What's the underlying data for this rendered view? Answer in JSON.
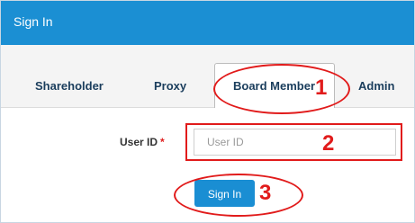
{
  "header": {
    "title": "Sign In"
  },
  "tabs": [
    {
      "label": "Shareholder"
    },
    {
      "label": "Proxy"
    },
    {
      "label": "Board Member"
    },
    {
      "label": "Admin"
    }
  ],
  "form": {
    "user_id_label": "User ID",
    "required_mark": "*",
    "user_id_placeholder": "User ID",
    "user_id_value": "",
    "submit_label": "Sign In"
  },
  "annotations": [
    {
      "number": "1"
    },
    {
      "number": "2"
    },
    {
      "number": "3"
    }
  ],
  "colors": {
    "header_bg": "#1b8fd3",
    "button_bg": "#1a8ed3",
    "annotation": "#e11b1b",
    "tab_text": "#1a3d5c"
  }
}
